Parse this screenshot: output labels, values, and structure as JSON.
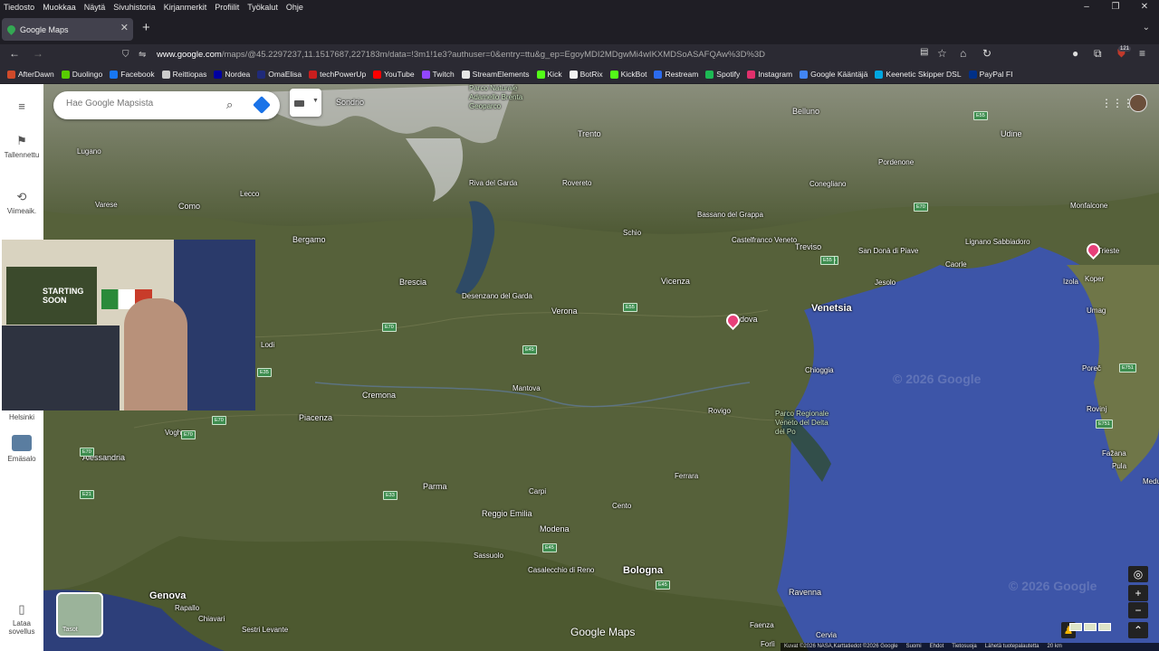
{
  "menubar": [
    "Tiedosto",
    "Muokkaa",
    "Näytä",
    "Sivuhistoria",
    "Kirjanmerkit",
    "Profiilit",
    "Työkalut",
    "Ohje"
  ],
  "window_controls": [
    "–",
    "❐",
    "✕"
  ],
  "tab": {
    "title": "Google Maps"
  },
  "address": {
    "host": "www.google.com",
    "path": "/maps/@45.2297237,11.1517687,227183m/data=!3m1!1e3?authuser=0&entry=ttu&g_ep=EgoyMDI2MDgwMi4wIKXMDSoASAFQAw%3D%3D"
  },
  "badge": "121",
  "bookmarks": [
    {
      "label": "AfterDawn",
      "color": "#d04a2a"
    },
    {
      "label": "Duolingo",
      "color": "#58cc02"
    },
    {
      "label": "Facebook",
      "color": "#1877f2"
    },
    {
      "label": "Reittiopas",
      "color": "#cccccc"
    },
    {
      "label": "Nordea",
      "color": "#0000a0"
    },
    {
      "label": "OmaElisa",
      "color": "#1f2a7a"
    },
    {
      "label": "techPowerUp",
      "color": "#c81e1e"
    },
    {
      "label": "YouTube",
      "color": "#ff0000"
    },
    {
      "label": "Twitch",
      "color": "#9146ff"
    },
    {
      "label": "StreamElements",
      "color": "#e6e6e6"
    },
    {
      "label": "Kick",
      "color": "#53fc18"
    },
    {
      "label": "BotRix",
      "color": "#f2f2f2"
    },
    {
      "label": "KickBot",
      "color": "#53fc18"
    },
    {
      "label": "Restream",
      "color": "#2c6bed"
    },
    {
      "label": "Spotify",
      "color": "#1db954"
    },
    {
      "label": "Instagram",
      "color": "#e1306c"
    },
    {
      "label": "Google Kääntäjä",
      "color": "#4285f4"
    },
    {
      "label": "Keenetic Skipper DSL",
      "color": "#00a7e1"
    },
    {
      "label": "PayPal FI",
      "color": "#003087"
    }
  ],
  "sidebar": {
    "saved": "Tallennettu",
    "recent": "Viimeaik.",
    "helsinki": "Helsinki",
    "emasalo": "Emäsalo",
    "download": "Lataa sovellus"
  },
  "search": {
    "placeholder": "Hae Google Mapsista"
  },
  "layers_label": "Tasot",
  "brand": "Google Maps",
  "watermark": "© 2026 Google",
  "webcam": {
    "sign": "STARTING SOON"
  },
  "cities": [
    {
      "name": "Sondrio"
    },
    {
      "name": "Trento"
    },
    {
      "name": "Belluno"
    },
    {
      "name": "Udine"
    },
    {
      "name": "Lugano"
    },
    {
      "name": "Riva del Garda"
    },
    {
      "name": "Rovereto"
    },
    {
      "name": "Pordenone"
    },
    {
      "name": "Varese"
    },
    {
      "name": "Como"
    },
    {
      "name": "Lecco"
    },
    {
      "name": "Conegliano"
    },
    {
      "name": "Bassano del Grappa"
    },
    {
      "name": "Monfalcone"
    },
    {
      "name": "Schio"
    },
    {
      "name": "Bergamo"
    },
    {
      "name": "Castelfranco Veneto"
    },
    {
      "name": "Treviso"
    },
    {
      "name": "San Donà di Piave"
    },
    {
      "name": "Lignano Sabbiadoro"
    },
    {
      "name": "Trieste"
    },
    {
      "name": "Caorle"
    },
    {
      "name": "Brescia"
    },
    {
      "name": "Vicenza"
    },
    {
      "name": "Jesolo"
    },
    {
      "name": "Izola"
    },
    {
      "name": "Koper"
    },
    {
      "name": "Desenzano del Garda"
    },
    {
      "name": "Verona"
    },
    {
      "name": "Padova"
    },
    {
      "name": "Venetsia"
    },
    {
      "name": "Umag"
    },
    {
      "name": "Lodi"
    },
    {
      "name": "Chioggia"
    },
    {
      "name": "Poreč"
    },
    {
      "name": "Mantova"
    },
    {
      "name": "Cremona"
    },
    {
      "name": "Piacenza"
    },
    {
      "name": "Rovigo"
    },
    {
      "name": "Parco Regionale Veneto del Delta del Po"
    },
    {
      "name": "Rovinj"
    },
    {
      "name": "Voghera"
    },
    {
      "name": "Alessandria"
    },
    {
      "name": "Ferrara"
    },
    {
      "name": "Fažana"
    },
    {
      "name": "Pula"
    },
    {
      "name": "Parma"
    },
    {
      "name": "Carpi"
    },
    {
      "name": "Medulin"
    },
    {
      "name": "Cento"
    },
    {
      "name": "Reggio Emilia"
    },
    {
      "name": "Modena"
    },
    {
      "name": "Sassuolo"
    },
    {
      "name": "Casalecchio di Reno"
    },
    {
      "name": "Bologna"
    },
    {
      "name": "Ravenna"
    },
    {
      "name": "Genova"
    },
    {
      "name": "Rapallo"
    },
    {
      "name": "Chiavari"
    },
    {
      "name": "Sestri Levante"
    },
    {
      "name": "Faenza"
    },
    {
      "name": "Forlì"
    },
    {
      "name": "Cervia"
    },
    {
      "name": "Parco Naturale Adamello Brenta Geoparco"
    }
  ],
  "roads": [
    "E55",
    "E70",
    "E70",
    "E70",
    "E45",
    "E70",
    "E35",
    "E70",
    "E21",
    "E25",
    "E33",
    "E45",
    "E751",
    "E751",
    "E55",
    "E55",
    "E45"
  ],
  "attribution": [
    "Kuvat ©2026 NASA,Karttatiedot ©2026 Google",
    "Suomi",
    "Ehdot",
    "Tietosuoja",
    "Lähetä tuotepalautetta",
    "20 km"
  ],
  "colors": {
    "sea": "#3d55a8",
    "land": "#4f5a35",
    "mountain": "#8a8e7c",
    "snow": "#e8e8ee",
    "pin": "#e8407a"
  }
}
